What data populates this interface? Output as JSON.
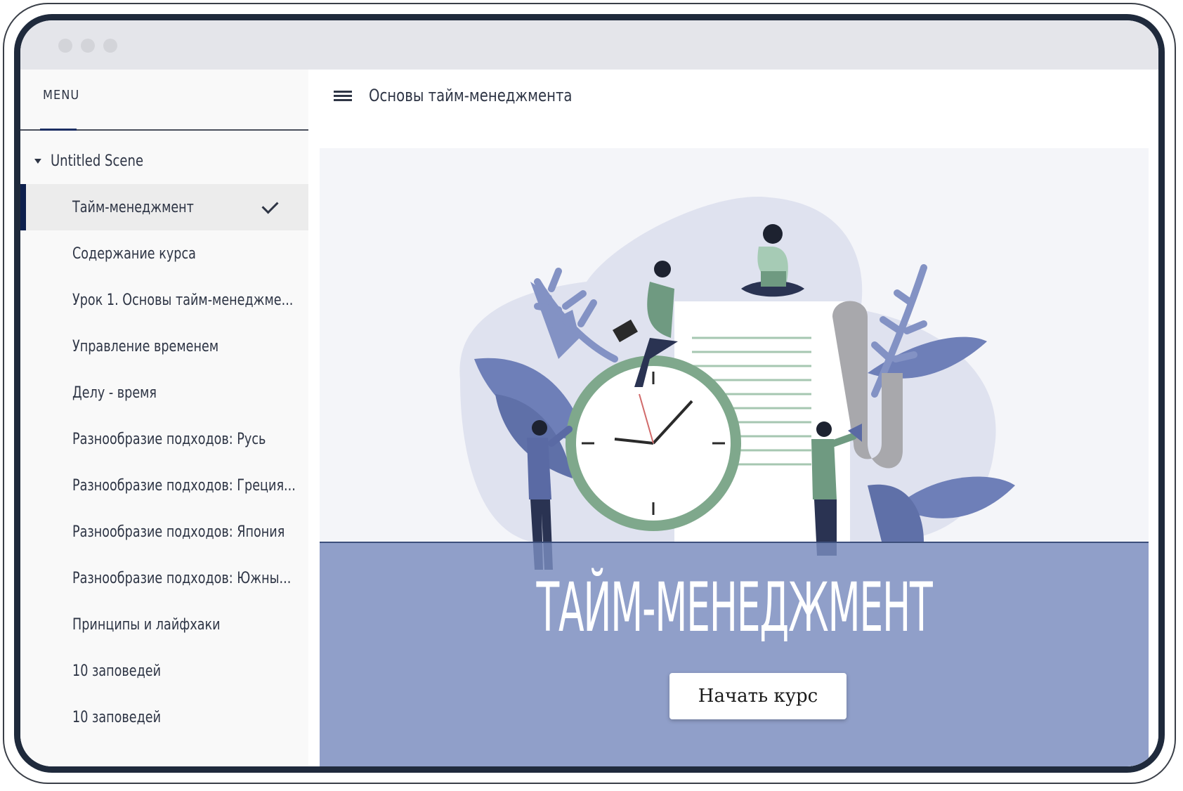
{
  "sidebar": {
    "menu_label": "MENU",
    "scene_title": "Untitled Scene",
    "items": [
      {
        "label": "Тайм-менеджмент",
        "active": true,
        "completed": true
      },
      {
        "label": "Содержание курса"
      },
      {
        "label": "Урок 1. Основы тайм-менеджме..."
      },
      {
        "label": "Управление временем"
      },
      {
        "label": "Делу - время"
      },
      {
        "label": "Разнообразие подходов: Русь"
      },
      {
        "label": "Разнообразие подходов: Греция..."
      },
      {
        "label": "Разнообразие подходов: Япония"
      },
      {
        "label": "Разнообразие подходов: Южны..."
      },
      {
        "label": "Принципы и лайфхаки"
      },
      {
        "label": "10 заповедей"
      },
      {
        "label": "10 заповедей"
      }
    ]
  },
  "header": {
    "title": "Основы тайм-менеджмента"
  },
  "hero": {
    "title": "ТАЙМ-МЕНЕДЖМЕНТ",
    "start_button": "Начать курс"
  },
  "colors": {
    "accent": "#0d1f4d",
    "band": "#8a9bc8",
    "illustration_blue": "#6b7db8",
    "illustration_green": "#7fa88c"
  }
}
